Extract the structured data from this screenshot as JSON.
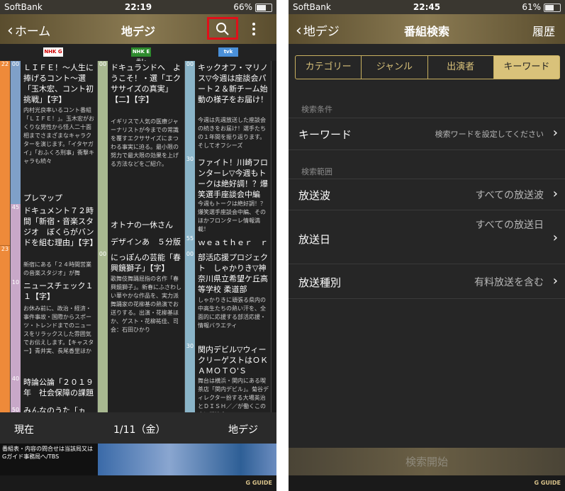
{
  "left": {
    "status": {
      "carrier": "SoftBank",
      "time": "22:19",
      "battery": "66%",
      "battery_level": 0.66
    },
    "nav": {
      "back_label": "ホーム",
      "title": "地デジ"
    },
    "channels": [
      "NHK G",
      "NHK Eテレ",
      "tvk"
    ],
    "hours": [
      "22",
      "23"
    ],
    "col1": [
      {
        "min": "00",
        "title": "ＬＩＦＥ！～人生に捧げるコント～選「玉木宏、コント初挑戦」【字】",
        "desc": "内村光良率いるコント番組「ＬＩＦＥ！」。玉木宏がおくりな男性から怪人二十面相までさまざまなキャラクターを演じます。「イタヤガイ」「おふくろ刑事」衝撃キャラも続々"
      },
      {
        "min": "",
        "title": "プレマップ",
        "desc": ""
      },
      {
        "min": "45",
        "title": "ドキュメント７２時間「新宿・音楽スタジオ　ぼくらがバンドを組む理由」【字】",
        "desc": "新宿にある「２４時間営業の音楽スタジオ」が舞"
      },
      {
        "min": "10",
        "title": "ニュースチェック１１【字】",
        "desc": "お休み前に、政治・経済・事件事故・国際からスポーツ・トレンドまでのニュースをリラックスした雰囲気でお伝えします。【キャスター】青井実、長尾香里ほか"
      },
      {
        "min": "40",
        "title": "時論公論「２０１９年　社会保障の課題",
        "desc": ""
      },
      {
        "min": "50",
        "title": "みんなのうた「ヵ",
        "desc": ""
      }
    ],
    "col2": [
      {
        "min": "00",
        "title": "ドキュランドへ　ようこそ！・選「エクササイズの真実」【二】【字】",
        "desc": "イギリスで人気の医療ジャーナリストが今までの常識を覆すエクササイズにまつわる事実に迫る。最小限の努力で最大限の効果を上げる方法などをご紹介。"
      },
      {
        "min": "",
        "title": "オトナの一休さん",
        "desc": ""
      },
      {
        "min": "",
        "title": "デザインあ　５分版",
        "desc": ""
      },
      {
        "min": "00",
        "title": "にっぽんの芸能「春興鏡獅子」【字】",
        "desc": "歌舞伎舞踊屈指の名作「春興鏡獅子」。新春にふさわしい華やかな作品を、実力派舞踊家の花柳基の熱演でお送りする。出演・花柳基ほか、ゲスト・花柳祐佳、司会：石田ひかり"
      }
    ],
    "col3": [
      {
        "min": "00",
        "title": "キックオフ・マリノス▽今週は座談会パート２＆新チーム始動の様子をお届け！",
        "desc": "今週は先週放送した座談会の続きをお届け！選手たちの１年間を振り返ります。そしてオフシーズ"
      },
      {
        "min": "30",
        "title": "ファイト！川崎フロンターレ▽今週もトークは絶好調！？爆笑選手座談会中編",
        "desc": "今週もトークは絶好調！？爆笑選手座談会中編、そのほかフロンターレ情報満載！"
      },
      {
        "min": "55",
        "title": "ｗｅａｔｈｅｒ　ｒｅ",
        "desc": ""
      },
      {
        "min": "00",
        "title": "部活応援プロジェクト　しゃかりき▽神奈川県立希望ケ丘高等学校 柔道部",
        "desc": "しゃかりきに頑張る県内の中高生たちの熱い汗を、全面的に応援する部活応援・情報バラエティ"
      },
      {
        "min": "30",
        "title": "関内デビル▽ウィークリーゲストはＯＫＡＭＯＴＯ'Ｓ",
        "desc": "舞台は横浜・関内にある喫茶店「関内デビル」。菊谷ディレクター扮する大場英治とＤＩＳＨ／／が働くこの店に常連客の"
      }
    ],
    "bottom": {
      "current": "現在",
      "date": "1/11（金）",
      "channel_type": "地デジ"
    },
    "ad_text": "番組表・内容の問合せは当該局又はGガイド事務局へ/TBS",
    "logo": "G GUIDE"
  },
  "right": {
    "status": {
      "carrier": "SoftBank",
      "time": "22:45",
      "battery": "61%",
      "battery_level": 0.61
    },
    "nav": {
      "back_label": "地デジ",
      "title": "番組検索",
      "history": "履歴"
    },
    "tabs": [
      "カテゴリー",
      "ジャンル",
      "出演者",
      "キーワード"
    ],
    "section_condition": "検索条件",
    "keyword": {
      "label": "キーワード",
      "placeholder": "検索ワードを設定してください"
    },
    "section_range": "検索範囲",
    "broadcast": {
      "label": "放送波",
      "value": "すべての放送波"
    },
    "date": {
      "label": "放送日",
      "value": "すべての放送日"
    },
    "kind": {
      "label": "放送種別",
      "value": "有料放送を含む"
    },
    "start_button": "検索開始",
    "logo": "G GUIDE"
  },
  "colors": {
    "accent_gold": "#d9c27a",
    "hour_orange": "#ee8a3a",
    "highlight_red": "#e0101a"
  }
}
